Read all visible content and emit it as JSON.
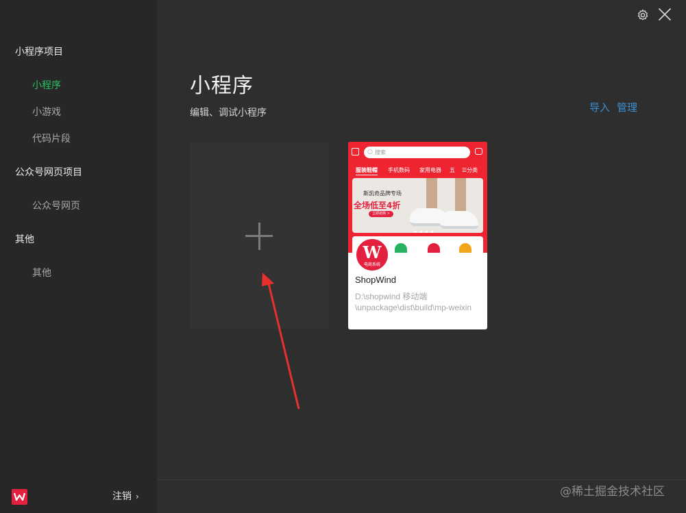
{
  "sidebar": {
    "sections": [
      {
        "title": "小程序项目",
        "items": [
          {
            "label": "小程序",
            "active": true
          },
          {
            "label": "小游戏"
          },
          {
            "label": "代码片段"
          }
        ]
      },
      {
        "title": "公众号网页项目",
        "items": [
          {
            "label": "公众号网页"
          }
        ]
      },
      {
        "title": "其他",
        "items": [
          {
            "label": "其他"
          }
        ]
      }
    ],
    "footer": {
      "logout_label": "注销",
      "chevron": "›"
    }
  },
  "main": {
    "title": "小程序",
    "subtitle": "编辑、调试小程序",
    "actions": {
      "import_label": "导入",
      "manage_label": "管理"
    },
    "new_project_icon": "plus-icon",
    "project": {
      "name": "ShopWind",
      "path_line1": "D:\\shopwind 移动端",
      "path_line2": "\\unpackage\\dist\\build\\mp-weixin",
      "logo_text": "W",
      "logo_caption": "电商系统",
      "thumbnail": {
        "search_placeholder": "搜索",
        "categories": [
          "服装鞋帽",
          "手机数码",
          "家用电器",
          "五",
          "☰分类"
        ],
        "banner_line1": "斯凯奇品牌专场",
        "banner_line2": "全场低至4折",
        "banner_button": "立即抢购 >"
      }
    },
    "watermark": "@稀土掘金技术社区"
  },
  "colors": {
    "accent_green": "#29c160",
    "link_blue": "#3b8fd3",
    "brand_red": "#e3213f"
  }
}
